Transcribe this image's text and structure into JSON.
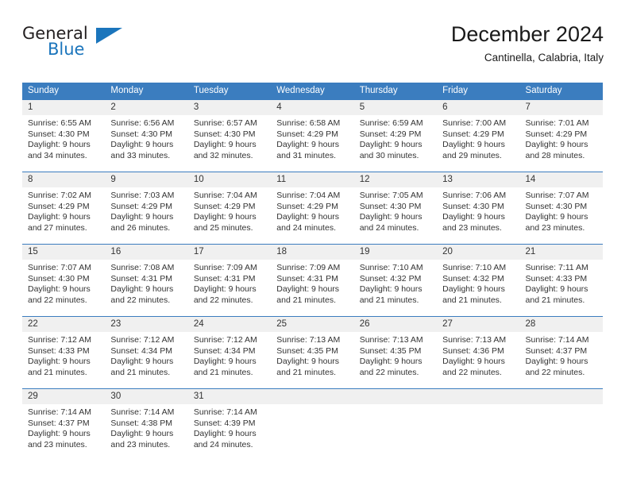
{
  "brand": {
    "name_part1": "General",
    "name_part2": "Blue",
    "color_dark": "#231f20",
    "color_blue": "#1b75bc"
  },
  "header": {
    "title": "December 2024",
    "subtitle": "Cantinella, Calabria, Italy"
  },
  "theme": {
    "header_row_bg": "#3b7dbf",
    "daynum_row_bg": "#f0f0f0",
    "separator": "#3b7dbf",
    "text": "#333333"
  },
  "weekdays": [
    "Sunday",
    "Monday",
    "Tuesday",
    "Wednesday",
    "Thursday",
    "Friday",
    "Saturday"
  ],
  "weeks": [
    {
      "daynums": [
        "1",
        "2",
        "3",
        "4",
        "5",
        "6",
        "7"
      ],
      "cells": [
        {
          "sunrise": "Sunrise: 6:55 AM",
          "sunset": "Sunset: 4:30 PM",
          "daylight1": "Daylight: 9 hours",
          "daylight2": "and 34 minutes."
        },
        {
          "sunrise": "Sunrise: 6:56 AM",
          "sunset": "Sunset: 4:30 PM",
          "daylight1": "Daylight: 9 hours",
          "daylight2": "and 33 minutes."
        },
        {
          "sunrise": "Sunrise: 6:57 AM",
          "sunset": "Sunset: 4:30 PM",
          "daylight1": "Daylight: 9 hours",
          "daylight2": "and 32 minutes."
        },
        {
          "sunrise": "Sunrise: 6:58 AM",
          "sunset": "Sunset: 4:29 PM",
          "daylight1": "Daylight: 9 hours",
          "daylight2": "and 31 minutes."
        },
        {
          "sunrise": "Sunrise: 6:59 AM",
          "sunset": "Sunset: 4:29 PM",
          "daylight1": "Daylight: 9 hours",
          "daylight2": "and 30 minutes."
        },
        {
          "sunrise": "Sunrise: 7:00 AM",
          "sunset": "Sunset: 4:29 PM",
          "daylight1": "Daylight: 9 hours",
          "daylight2": "and 29 minutes."
        },
        {
          "sunrise": "Sunrise: 7:01 AM",
          "sunset": "Sunset: 4:29 PM",
          "daylight1": "Daylight: 9 hours",
          "daylight2": "and 28 minutes."
        }
      ]
    },
    {
      "daynums": [
        "8",
        "9",
        "10",
        "11",
        "12",
        "13",
        "14"
      ],
      "cells": [
        {
          "sunrise": "Sunrise: 7:02 AM",
          "sunset": "Sunset: 4:29 PM",
          "daylight1": "Daylight: 9 hours",
          "daylight2": "and 27 minutes."
        },
        {
          "sunrise": "Sunrise: 7:03 AM",
          "sunset": "Sunset: 4:29 PM",
          "daylight1": "Daylight: 9 hours",
          "daylight2": "and 26 minutes."
        },
        {
          "sunrise": "Sunrise: 7:04 AM",
          "sunset": "Sunset: 4:29 PM",
          "daylight1": "Daylight: 9 hours",
          "daylight2": "and 25 minutes."
        },
        {
          "sunrise": "Sunrise: 7:04 AM",
          "sunset": "Sunset: 4:29 PM",
          "daylight1": "Daylight: 9 hours",
          "daylight2": "and 24 minutes."
        },
        {
          "sunrise": "Sunrise: 7:05 AM",
          "sunset": "Sunset: 4:30 PM",
          "daylight1": "Daylight: 9 hours",
          "daylight2": "and 24 minutes."
        },
        {
          "sunrise": "Sunrise: 7:06 AM",
          "sunset": "Sunset: 4:30 PM",
          "daylight1": "Daylight: 9 hours",
          "daylight2": "and 23 minutes."
        },
        {
          "sunrise": "Sunrise: 7:07 AM",
          "sunset": "Sunset: 4:30 PM",
          "daylight1": "Daylight: 9 hours",
          "daylight2": "and 23 minutes."
        }
      ]
    },
    {
      "daynums": [
        "15",
        "16",
        "17",
        "18",
        "19",
        "20",
        "21"
      ],
      "cells": [
        {
          "sunrise": "Sunrise: 7:07 AM",
          "sunset": "Sunset: 4:30 PM",
          "daylight1": "Daylight: 9 hours",
          "daylight2": "and 22 minutes."
        },
        {
          "sunrise": "Sunrise: 7:08 AM",
          "sunset": "Sunset: 4:31 PM",
          "daylight1": "Daylight: 9 hours",
          "daylight2": "and 22 minutes."
        },
        {
          "sunrise": "Sunrise: 7:09 AM",
          "sunset": "Sunset: 4:31 PM",
          "daylight1": "Daylight: 9 hours",
          "daylight2": "and 22 minutes."
        },
        {
          "sunrise": "Sunrise: 7:09 AM",
          "sunset": "Sunset: 4:31 PM",
          "daylight1": "Daylight: 9 hours",
          "daylight2": "and 21 minutes."
        },
        {
          "sunrise": "Sunrise: 7:10 AM",
          "sunset": "Sunset: 4:32 PM",
          "daylight1": "Daylight: 9 hours",
          "daylight2": "and 21 minutes."
        },
        {
          "sunrise": "Sunrise: 7:10 AM",
          "sunset": "Sunset: 4:32 PM",
          "daylight1": "Daylight: 9 hours",
          "daylight2": "and 21 minutes."
        },
        {
          "sunrise": "Sunrise: 7:11 AM",
          "sunset": "Sunset: 4:33 PM",
          "daylight1": "Daylight: 9 hours",
          "daylight2": "and 21 minutes."
        }
      ]
    },
    {
      "daynums": [
        "22",
        "23",
        "24",
        "25",
        "26",
        "27",
        "28"
      ],
      "cells": [
        {
          "sunrise": "Sunrise: 7:12 AM",
          "sunset": "Sunset: 4:33 PM",
          "daylight1": "Daylight: 9 hours",
          "daylight2": "and 21 minutes."
        },
        {
          "sunrise": "Sunrise: 7:12 AM",
          "sunset": "Sunset: 4:34 PM",
          "daylight1": "Daylight: 9 hours",
          "daylight2": "and 21 minutes."
        },
        {
          "sunrise": "Sunrise: 7:12 AM",
          "sunset": "Sunset: 4:34 PM",
          "daylight1": "Daylight: 9 hours",
          "daylight2": "and 21 minutes."
        },
        {
          "sunrise": "Sunrise: 7:13 AM",
          "sunset": "Sunset: 4:35 PM",
          "daylight1": "Daylight: 9 hours",
          "daylight2": "and 21 minutes."
        },
        {
          "sunrise": "Sunrise: 7:13 AM",
          "sunset": "Sunset: 4:35 PM",
          "daylight1": "Daylight: 9 hours",
          "daylight2": "and 22 minutes."
        },
        {
          "sunrise": "Sunrise: 7:13 AM",
          "sunset": "Sunset: 4:36 PM",
          "daylight1": "Daylight: 9 hours",
          "daylight2": "and 22 minutes."
        },
        {
          "sunrise": "Sunrise: 7:14 AM",
          "sunset": "Sunset: 4:37 PM",
          "daylight1": "Daylight: 9 hours",
          "daylight2": "and 22 minutes."
        }
      ]
    },
    {
      "daynums": [
        "29",
        "30",
        "31",
        "",
        "",
        "",
        ""
      ],
      "cells": [
        {
          "sunrise": "Sunrise: 7:14 AM",
          "sunset": "Sunset: 4:37 PM",
          "daylight1": "Daylight: 9 hours",
          "daylight2": "and 23 minutes."
        },
        {
          "sunrise": "Sunrise: 7:14 AM",
          "sunset": "Sunset: 4:38 PM",
          "daylight1": "Daylight: 9 hours",
          "daylight2": "and 23 minutes."
        },
        {
          "sunrise": "Sunrise: 7:14 AM",
          "sunset": "Sunset: 4:39 PM",
          "daylight1": "Daylight: 9 hours",
          "daylight2": "and 24 minutes."
        },
        {
          "sunrise": "",
          "sunset": "",
          "daylight1": "",
          "daylight2": ""
        },
        {
          "sunrise": "",
          "sunset": "",
          "daylight1": "",
          "daylight2": ""
        },
        {
          "sunrise": "",
          "sunset": "",
          "daylight1": "",
          "daylight2": ""
        },
        {
          "sunrise": "",
          "sunset": "",
          "daylight1": "",
          "daylight2": ""
        }
      ]
    }
  ]
}
